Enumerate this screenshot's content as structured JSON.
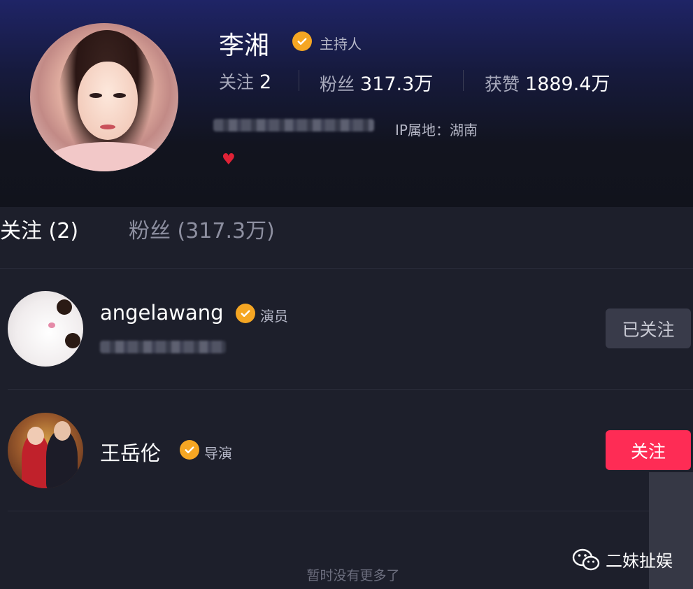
{
  "profile": {
    "name": "李湘",
    "role": "主持人",
    "stats": [
      {
        "label": "关注",
        "value": "2"
      },
      {
        "label": "粉丝",
        "value": "317.3万"
      },
      {
        "label": "获赞",
        "value": "1889.4万"
      }
    ],
    "ip_location": "IP属地：湖南",
    "heart_icon": "heart-icon"
  },
  "tabs": [
    {
      "label": "关注 (2)",
      "active": true
    },
    {
      "label": "粉丝 (317.3万)",
      "active": false
    }
  ],
  "following": [
    {
      "name": "angelawang",
      "role": "演员",
      "button": "已关注"
    },
    {
      "name": "王岳伦",
      "role": "导演",
      "button": "关注"
    }
  ],
  "end_text": "暂时没有更多了",
  "watermark": {
    "label": "二妹扯娱",
    "icon": "wechat-icon"
  },
  "colors": {
    "verify_badge": "#f5a623",
    "follow_button": "#fe2c55",
    "followed_button": "#393b4a",
    "heart": "#e02236"
  }
}
